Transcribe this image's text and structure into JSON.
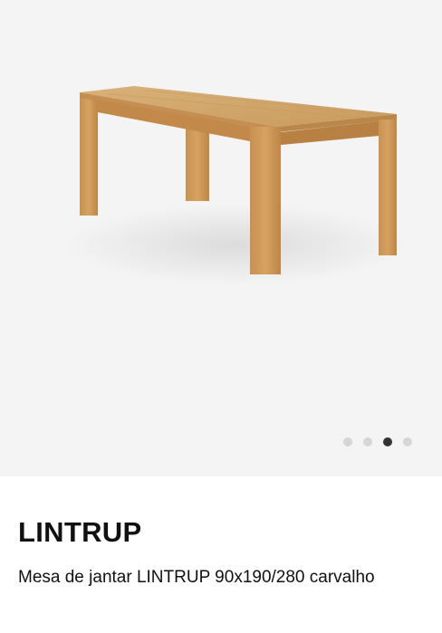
{
  "gallery": {
    "image_alt": "LINTRUP",
    "dots": [
      {
        "active": false
      },
      {
        "active": false
      },
      {
        "active": true
      },
      {
        "active": false
      }
    ]
  },
  "product": {
    "name": "LINTRUP",
    "description": "Mesa de jantar LINTRUP 90x190/280 carvalho"
  }
}
